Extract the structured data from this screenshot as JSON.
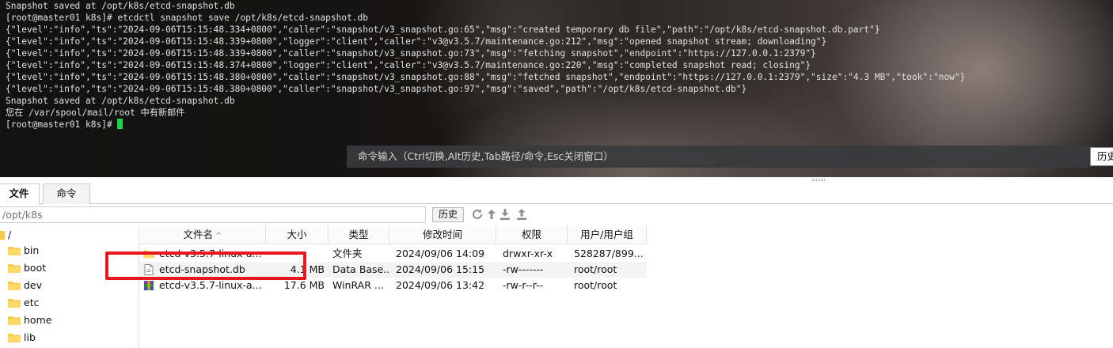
{
  "terminal": {
    "lines": [
      "Snapshot saved at /opt/k8s/etcd-snapshot.db",
      "[root@master01 k8s]# etcdctl snapshot save /opt/k8s/etcd-snapshot.db",
      "{\"level\":\"info\",\"ts\":\"2024-09-06T15:15:48.334+0800\",\"caller\":\"snapshot/v3_snapshot.go:65\",\"msg\":\"created temporary db file\",\"path\":\"/opt/k8s/etcd-snapshot.db.part\"}",
      "{\"level\":\"info\",\"ts\":\"2024-09-06T15:15:48.339+0800\",\"logger\":\"client\",\"caller\":\"v3@v3.5.7/maintenance.go:212\",\"msg\":\"opened snapshot stream; downloading\"}",
      "{\"level\":\"info\",\"ts\":\"2024-09-06T15:15:48.339+0800\",\"caller\":\"snapshot/v3_snapshot.go:73\",\"msg\":\"fetching snapshot\",\"endpoint\":\"https://127.0.0.1:2379\"}",
      "{\"level\":\"info\",\"ts\":\"2024-09-06T15:15:48.374+0800\",\"logger\":\"client\",\"caller\":\"v3@v3.5.7/maintenance.go:220\",\"msg\":\"completed snapshot read; closing\"}",
      "{\"level\":\"info\",\"ts\":\"2024-09-06T15:15:48.380+0800\",\"caller\":\"snapshot/v3_snapshot.go:88\",\"msg\":\"fetched snapshot\",\"endpoint\":\"https://127.0.0.1:2379\",\"size\":\"4.3 MB\",\"took\":\"now\"}",
      "{\"level\":\"info\",\"ts\":\"2024-09-06T15:15:48.380+0800\",\"caller\":\"snapshot/v3_snapshot.go:97\",\"msg\":\"saved\",\"path\":\"/opt/k8s/etcd-snapshot.db\"}",
      "Snapshot saved at /opt/k8s/etcd-snapshot.db",
      "您在 /var/spool/mail/root 中有新邮件"
    ],
    "prompt": "[root@master01 k8s]# ",
    "cursor_color": "#1fd34a",
    "command_bar_hint": "命令输入（Ctrl切换,Alt历史,Tab路径/命令,Esc关闭窗口）",
    "history_button": "历史"
  },
  "tabs": [
    {
      "label": "文件"
    },
    {
      "label": "命令"
    }
  ],
  "path_bar": {
    "path": "/opt/k8s",
    "history_label": "历史",
    "tools": [
      "refresh-icon",
      "up-arrow-icon",
      "download-icon",
      "upload-icon"
    ]
  },
  "tree": {
    "root": "/",
    "items": [
      "bin",
      "boot",
      "dev",
      "etc",
      "home",
      "lib"
    ]
  },
  "file_list": {
    "columns": [
      "文件名",
      "大小",
      "类型",
      "修改时间",
      "权限",
      "用户/用户组"
    ],
    "sort_indicator": "^",
    "rows": [
      {
        "icon": "folder-icon",
        "name": "etcd-v3.5.7-linux-a...",
        "size": "",
        "type": "文件夹",
        "modified": "2024/09/06 14:09",
        "perm": "drwxr-xr-x",
        "owner": "528287/899..."
      },
      {
        "icon": "file-icon",
        "name": "etcd-snapshot.db",
        "size": "4.1 MB",
        "type": "Data Base...",
        "modified": "2024/09/06 15:15",
        "perm": "-rw-------",
        "owner": "root/root"
      },
      {
        "icon": "archive-icon",
        "name": "etcd-v3.5.7-linux-a...",
        "size": "17.6 MB",
        "type": "WinRAR ...",
        "modified": "2024/09/06 13:42",
        "perm": "-rw-r--r--",
        "owner": "root/root"
      }
    ]
  },
  "colors": {
    "highlight_box": "#e5171f",
    "folder": "#f5c94a"
  }
}
